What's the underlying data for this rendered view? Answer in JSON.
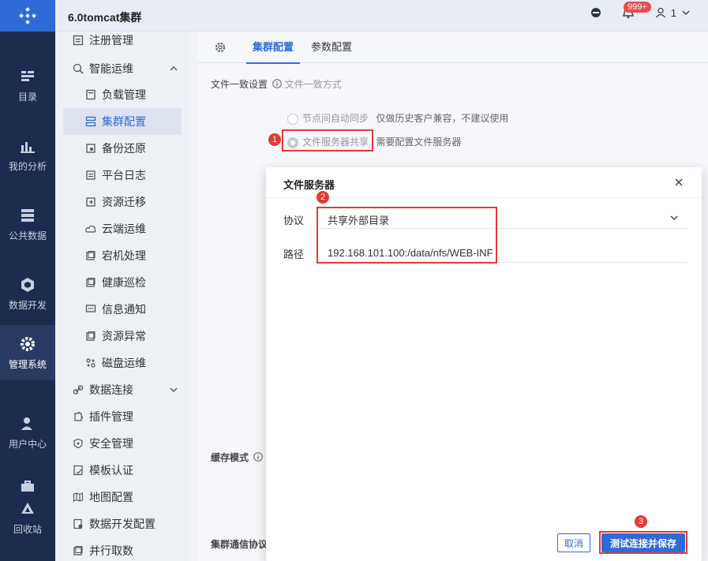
{
  "app_title": "6.0tomcat集群",
  "notification_badge": "999+",
  "user_label": "1",
  "rail": [
    {
      "label": "目录",
      "icon": "catalog-icon"
    },
    {
      "label": "我的分析",
      "icon": "analysis-icon"
    },
    {
      "label": "公共数据",
      "icon": "data-icon"
    },
    {
      "label": "数据开发",
      "icon": "dev-icon"
    },
    {
      "label": "管理系统",
      "icon": "gear-icon"
    },
    {
      "label": "用户中心",
      "icon": "user-icon"
    },
    {
      "label": "回收站",
      "icon": "recycle-icon"
    }
  ],
  "sidebar": {
    "items": [
      {
        "label": "注册管理",
        "level": 1
      },
      {
        "label": "智能运维",
        "level": 1
      },
      {
        "label": "负载管理",
        "level": 2
      },
      {
        "label": "集群配置",
        "level": 2
      },
      {
        "label": "备份还原",
        "level": 2
      },
      {
        "label": "平台日志",
        "level": 2
      },
      {
        "label": "资源迁移",
        "level": 2
      },
      {
        "label": "云端运维",
        "level": 2
      },
      {
        "label": "宕机处理",
        "level": 2
      },
      {
        "label": "健康巡检",
        "level": 2
      },
      {
        "label": "信息通知",
        "level": 2
      },
      {
        "label": "资源异常",
        "level": 2
      },
      {
        "label": "磁盘运维",
        "level": 2
      },
      {
        "label": "数据连接",
        "level": 1
      },
      {
        "label": "插件管理",
        "level": 1
      },
      {
        "label": "安全管理",
        "level": 1
      },
      {
        "label": "模板认证",
        "level": 1
      },
      {
        "label": "地图配置",
        "level": 1
      },
      {
        "label": "数据开发配置",
        "level": 1
      },
      {
        "label": "并行取数",
        "level": 1
      }
    ]
  },
  "main": {
    "tabs": [
      "集群配置",
      "参数配置"
    ],
    "file_consistency_label": "文件一致设置",
    "file_consistency_hint": "文件一致方式",
    "option1_label": "节点间自动同步",
    "option1_desc": "仅做历史客户兼容，不建议使用",
    "option2_label": "文件服务器共享",
    "option2_desc": "需要配置文件服务器",
    "cache_mode_label": "缓存模式",
    "cluster_comm_label": "集群通信协议"
  },
  "modal": {
    "title": "文件服务器",
    "protocol_label": "协议",
    "protocol_value": "共享外部目录",
    "path_label": "路径",
    "path_value": "192.168.101.100:/data/nfs/WEB-INF",
    "cancel_label": "取消",
    "primary_label": "测试连接并保存"
  },
  "markers": [
    "1",
    "2",
    "3"
  ],
  "colors": {
    "accent": "#2f6bd8",
    "rail": "#1d2b4f",
    "annotation": "#e53935"
  }
}
